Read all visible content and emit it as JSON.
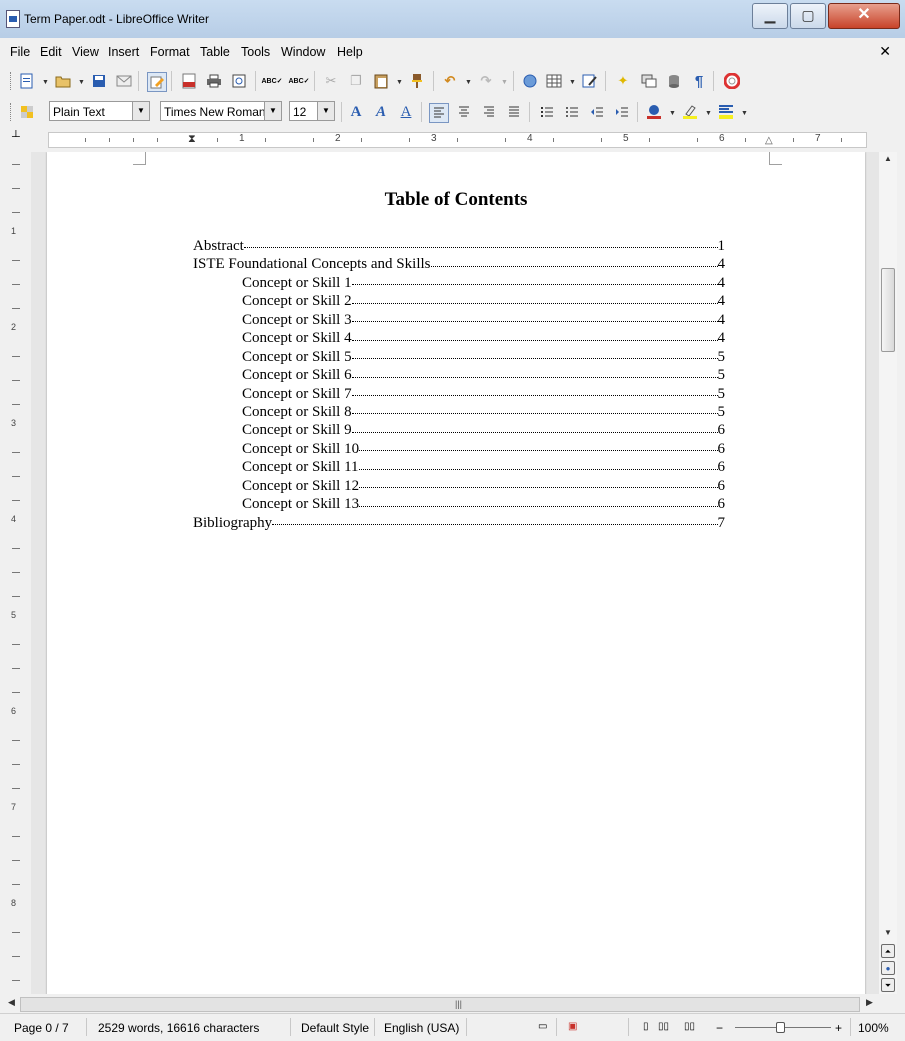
{
  "window": {
    "title": "Term Paper.odt - LibreOffice Writer",
    "min_glyph": "▁",
    "max_glyph": "▢",
    "close_glyph": "✕",
    "doc_close_glyph": "✕"
  },
  "menu": [
    "File",
    "Edit",
    "View",
    "Insert",
    "Format",
    "Table",
    "Tools",
    "Window",
    "Help"
  ],
  "formatting": {
    "paragraph_style": "Plain Text",
    "font_name": "Times New Roman",
    "font_size": "12"
  },
  "ruler": {
    "h_labels": [
      "1",
      "2",
      "3",
      "4",
      "5",
      "6",
      "7"
    ],
    "v_labels": [
      "1",
      "2",
      "3",
      "4",
      "5",
      "6",
      "7",
      "8"
    ]
  },
  "document": {
    "toc_title": "Table of Contents",
    "toc": [
      {
        "text": "Abstract",
        "page": "1",
        "level": 1
      },
      {
        "text": "ISTE Foundational Concepts and Skills",
        "page": "4",
        "level": 1
      },
      {
        "text": "Concept or Skill 1",
        "page": "4",
        "level": 2
      },
      {
        "text": "Concept or Skill 2",
        "page": "4",
        "level": 2
      },
      {
        "text": "Concept or Skill 3",
        "page": "4",
        "level": 2
      },
      {
        "text": "Concept or Skill 4",
        "page": "4",
        "level": 2
      },
      {
        "text": "Concept or Skill 5",
        "page": "5",
        "level": 2
      },
      {
        "text": "Concept or Skill 6",
        "page": "5",
        "level": 2
      },
      {
        "text": "Concept or Skill 7",
        "page": "5",
        "level": 2
      },
      {
        "text": "Concept or Skill 8",
        "page": "5",
        "level": 2
      },
      {
        "text": "Concept or Skill 9",
        "page": "6",
        "level": 2
      },
      {
        "text": "Concept or Skill 10",
        "page": "6",
        "level": 2
      },
      {
        "text": "Concept or Skill 11",
        "page": "6",
        "level": 2
      },
      {
        "text": "Concept or Skill 12",
        "page": "6",
        "level": 2
      },
      {
        "text": "Concept or Skill 13",
        "page": "6",
        "level": 2
      },
      {
        "text": "Bibliography",
        "page": "7",
        "level": 1
      }
    ]
  },
  "status": {
    "page": "Page 0 / 7",
    "words": "2529 words, 16616 characters",
    "style": "Default Style",
    "language": "English (USA)",
    "zoom": "100%"
  }
}
